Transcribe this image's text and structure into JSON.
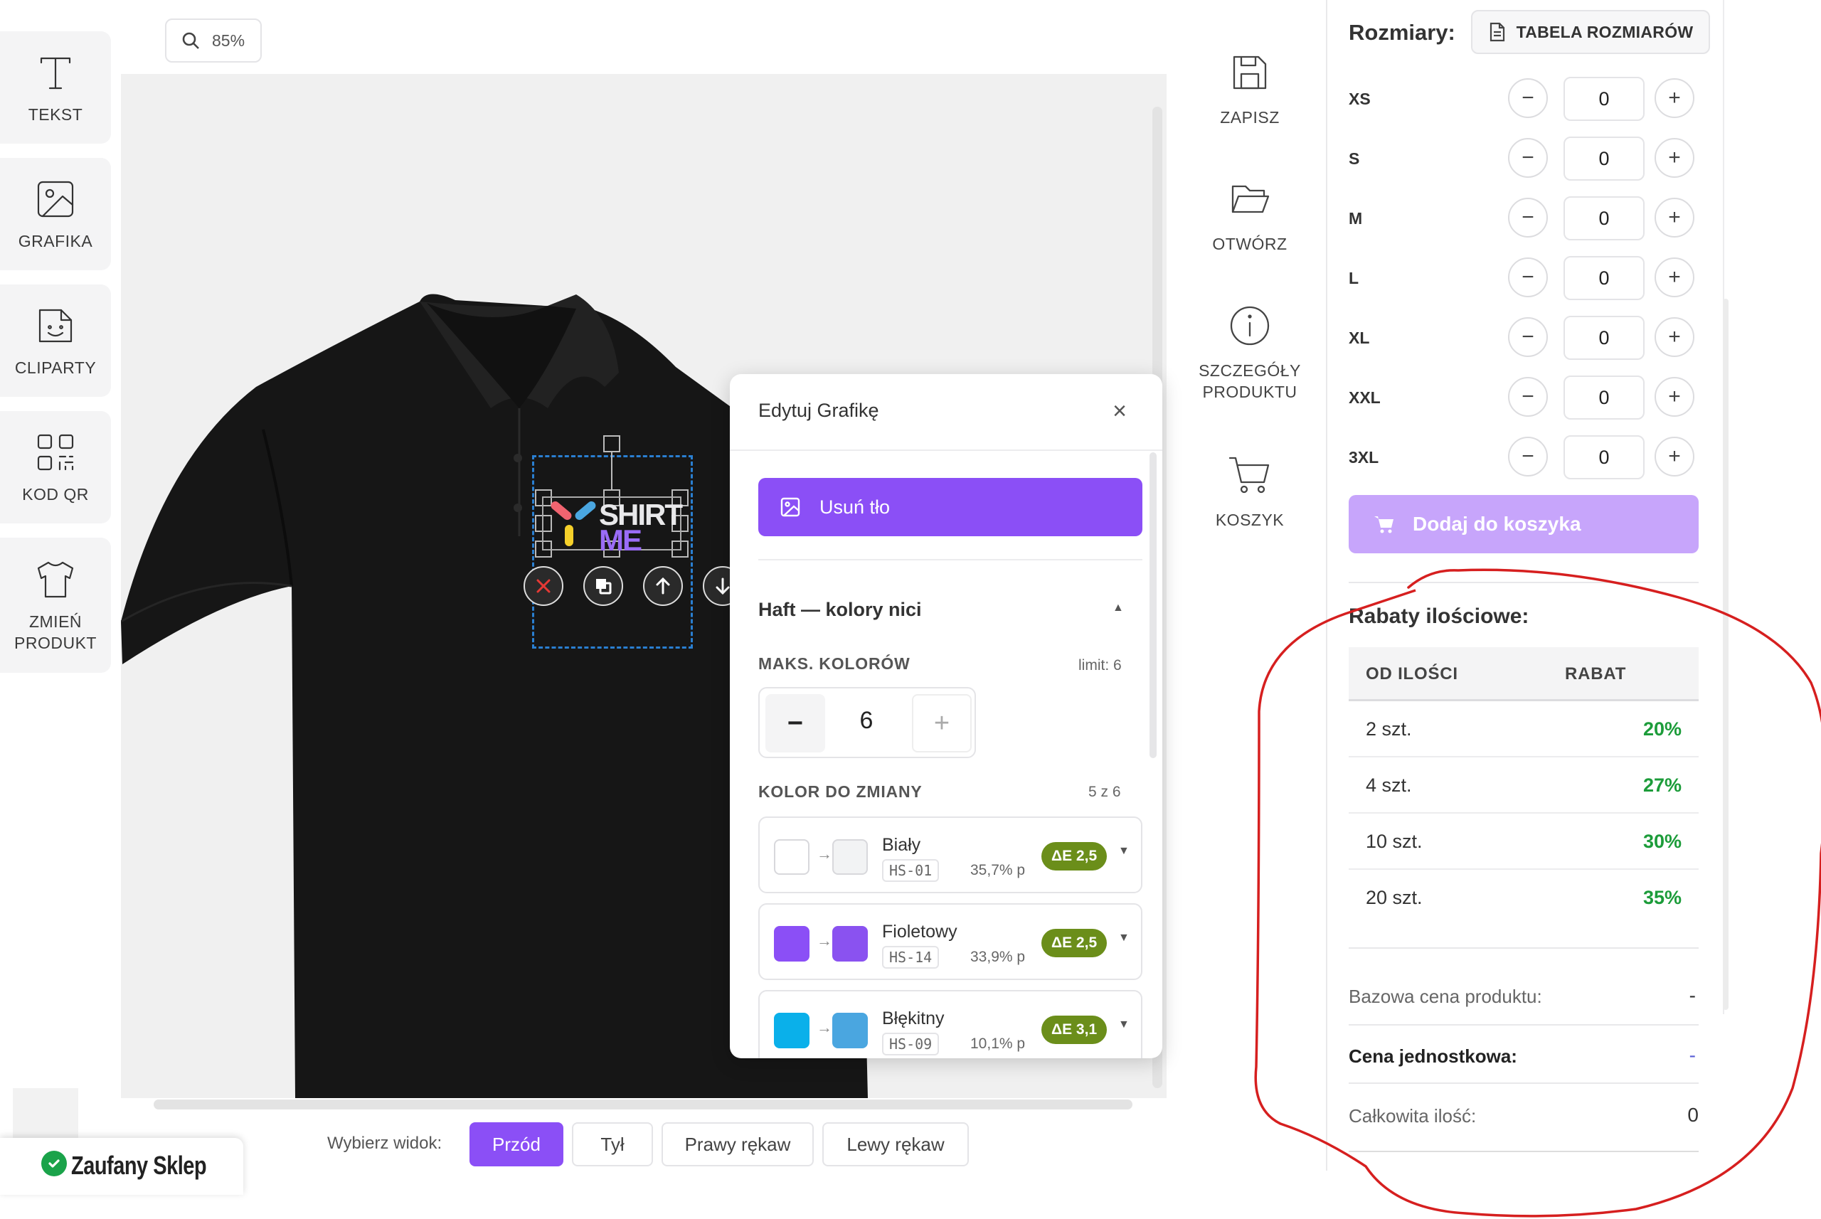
{
  "left_toolbar": [
    {
      "label": "TEKST",
      "icon": "text-icon"
    },
    {
      "label": "GRAFIKA",
      "icon": "image-icon"
    },
    {
      "label": "CLIPARTY",
      "icon": "clipart-icon"
    },
    {
      "label": "KOD QR",
      "icon": "qr-code-icon"
    },
    {
      "label": "ZMIEŃ PRODUKT",
      "icon": "tshirt-icon"
    }
  ],
  "zoom": {
    "value": "85%"
  },
  "design": {
    "line1": "SHIRT",
    "line2": "ME"
  },
  "view_selector": {
    "label": "Wybierz widok:",
    "options": [
      "Przód",
      "Tył",
      "Prawy rękaw",
      "Lewy rękaw"
    ],
    "selected": "Przód"
  },
  "trust_badge": {
    "label": "Zaufany Sklep"
  },
  "actions": [
    {
      "label": "ZAPISZ",
      "icon": "save-icon"
    },
    {
      "label": "OTWÓRZ",
      "icon": "folder-open-icon"
    },
    {
      "label": "SZCZEGÓŁY PRODUKTU",
      "icon": "info-icon"
    },
    {
      "label": "KOSZYK",
      "icon": "cart-icon"
    }
  ],
  "edit_dialog": {
    "title": "Edytuj Grafikę",
    "close": "×",
    "remove_bg_label": "Usuń tło",
    "section_title": "Haft — kolory nici",
    "max_colors_label": "MAKS. KOLORÓW",
    "max_colors_limit": "limit: 6",
    "max_colors_value": "6",
    "minus": "−",
    "plus": "+",
    "color_change_label": "KOLOR DO ZMIANY",
    "color_change_count": "5 z 6",
    "colors": [
      {
        "name": "Biały",
        "code": "HS-01",
        "percent": "35,7% p",
        "delta": "ΔE 2,5",
        "from": "#ffffff",
        "to": "#f2f3f4"
      },
      {
        "name": "Fioletowy",
        "code": "HS-14",
        "percent": "33,9% p",
        "delta": "ΔE 2,5",
        "from": "#8b4ff6",
        "to": "#8a52f0"
      },
      {
        "name": "Błękitny",
        "code": "HS-09",
        "percent": "10,1% p",
        "delta": "ΔE 3,1",
        "from": "#0ab0ea",
        "to": "#4aa6e0"
      }
    ]
  },
  "sizes": {
    "title": "Rozmiary:",
    "table_button": "TABELA ROZMIARÓW",
    "rows": [
      {
        "name": "XS",
        "qty": "0"
      },
      {
        "name": "S",
        "qty": "0"
      },
      {
        "name": "M",
        "qty": "0"
      },
      {
        "name": "L",
        "qty": "0"
      },
      {
        "name": "XL",
        "qty": "0"
      },
      {
        "name": "XXL",
        "qty": "0"
      },
      {
        "name": "3XL",
        "qty": "0"
      }
    ],
    "minus": "−",
    "plus": "+"
  },
  "add_to_cart": "Dodaj do koszyka",
  "discounts": {
    "title": "Rabaty ilościowe:",
    "col_qty": "OD ILOŚCI",
    "col_disc": "RABAT",
    "rows": [
      {
        "qty": "2 szt.",
        "discount": "20%"
      },
      {
        "qty": "4 szt.",
        "discount": "27%"
      },
      {
        "qty": "10 szt.",
        "discount": "30%"
      },
      {
        "qty": "20 szt.",
        "discount": "35%"
      }
    ]
  },
  "summary": {
    "base_price_label": "Bazowa cena produktu:",
    "base_price_value": "-",
    "unit_price_label": "Cena jednostkowa:",
    "unit_price_value": "-",
    "total_qty_label": "Całkowita ilość:",
    "total_qty_value": "0"
  },
  "colors": {
    "accent": "#8b4ff6",
    "accent_light": "#c7a5fb",
    "discount_green": "#1c9c3a",
    "annotation_red": "#d61f1f",
    "shirt": "#161616"
  }
}
